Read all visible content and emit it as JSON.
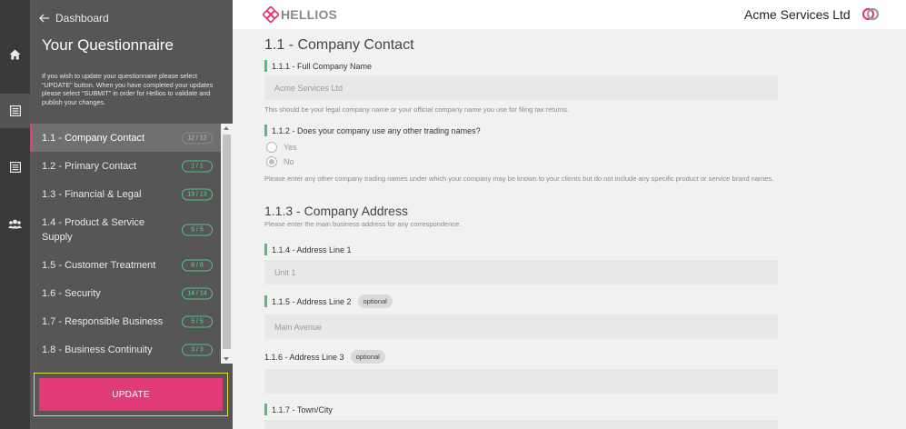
{
  "sidebar": {
    "back_label": "Dashboard",
    "title": "Your Questionnaire",
    "description": "If you wish to update your questionnaire please select \"UPDATE\" button. When you have completed your updates please select \"SUBMIT\" in order for Hellios to validate and publish your changes.",
    "sections": [
      {
        "label": "1.1 - Company Contact",
        "count": "12 / 12",
        "active": true
      },
      {
        "label": "1.2 - Primary Contact",
        "count": "1 / 1"
      },
      {
        "label": "1.3 - Financial & Legal",
        "count": "13 / 13"
      },
      {
        "label": "1.4 - Product & Service Supply",
        "count": "5 / 5"
      },
      {
        "label": "1.5 - Customer Treatment",
        "count": "8 / 8"
      },
      {
        "label": "1.6 - Security",
        "count": "14 / 14"
      },
      {
        "label": "1.7 - Responsible Business",
        "count": "5 / 5"
      },
      {
        "label": "1.8 - Business Continuity",
        "count": "3 / 3"
      }
    ],
    "update_label": "UPDATE"
  },
  "rail": {
    "icons": [
      "home-icon",
      "questionnaire-icon",
      "list-icon",
      "users-icon"
    ]
  },
  "header": {
    "logo_text": "HELLIOS",
    "company": "Acme Services Ltd"
  },
  "form": {
    "section_title": "1.1 - Company Contact",
    "q111": {
      "label": "1.1.1 - Full Company Name",
      "value": "Acme Services Ltd",
      "hint": "This should be your legal company name or your official company name you use for filing tax returns."
    },
    "q112": {
      "label": "1.1.2 - Does your company use any other trading names?",
      "yes": "Yes",
      "no": "No",
      "selected": "No",
      "hint": "Please enter any other company trading names under which your company may be known to your clients but do not include any specific product or service brand names."
    },
    "address_title": "1.1.3 - Company Address",
    "address_hint": "Please enter the main business address for any correspondence.",
    "q114": {
      "label": "1.1.4 - Address Line 1",
      "value": "Unit 1"
    },
    "q115": {
      "label": "1.1.5 - Address Line 2",
      "tag": "optional",
      "value": "Main Avenue"
    },
    "q116": {
      "label": "1.1.6 - Address Line 3",
      "tag": "optional",
      "value": ""
    },
    "q117": {
      "label": "1.1.7 - Town/City",
      "value": ""
    }
  },
  "colors": {
    "accent": "#e03b78",
    "required": "#4cc27c",
    "counter": "#53c28b",
    "highlight": "#e6e233"
  }
}
